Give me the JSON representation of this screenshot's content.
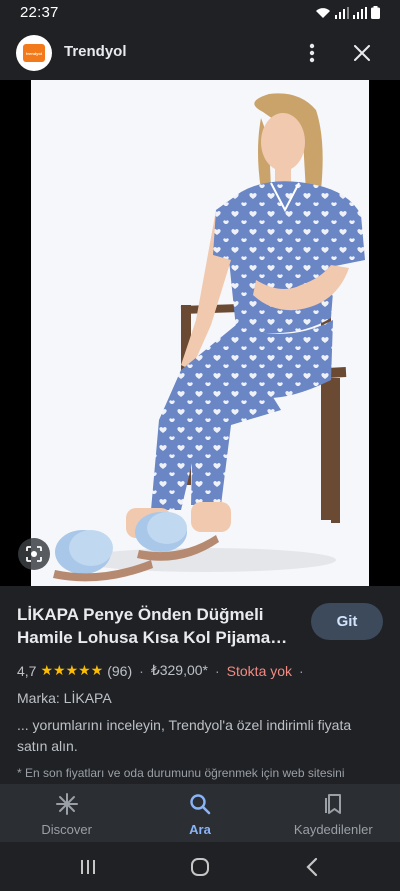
{
  "status_bar": {
    "time": "22:37"
  },
  "app_bar": {
    "title": "Trendyol",
    "logo_text": "trendyol"
  },
  "image": {
    "alt": "LİKAPA Penye Önden Düğmeli Hamile Lohusa Kısa Kol Pijama"
  },
  "product": {
    "title": "LİKAPA Penye Önden Düğmeli Hamile Lohusa Kısa Kol Pijama…",
    "go_button": "Git",
    "rating": "4,7",
    "stars": "★★★★★",
    "review_count": "(96)",
    "price": "₺329,00*",
    "stock": "Stokta yok",
    "trailing_sep": "·",
    "brand": "Marka: LİKAPA",
    "description": "... yorumlarını inceleyin, Trendyol'a özel indirimli fiyata satın alın.",
    "footnote": "* En son fiyatları ve oda durumunu öğrenmek için web sitesini"
  },
  "bottom_nav": {
    "items": [
      {
        "label": "Discover",
        "icon": "asterisk-icon",
        "active": false
      },
      {
        "label": "Ara",
        "icon": "search-icon",
        "active": true
      },
      {
        "label": "Kaydedilenler",
        "icon": "bookmarks-icon",
        "active": false
      }
    ]
  },
  "colors": {
    "background": "#1f2125",
    "accent": "#8ab4f8",
    "stock_out": "#f28b82",
    "stars": "#fbbc04",
    "pajama": "#6a86c4"
  }
}
